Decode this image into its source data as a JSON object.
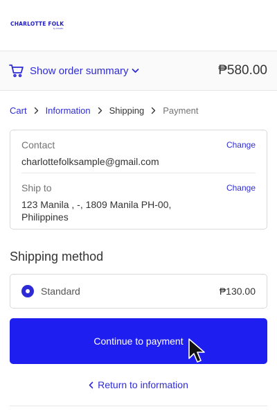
{
  "brand": {
    "name": "CHARLOTTE FOLK",
    "tagline": "by cinnabu"
  },
  "summary": {
    "toggle_label": "Show order summary",
    "total": "₱580.00"
  },
  "breadcrumb": {
    "cart": "Cart",
    "information": "Information",
    "shipping": "Shipping",
    "payment": "Payment"
  },
  "review": {
    "contact_label": "Contact",
    "contact_value": "charlottefolksample@gmail.com",
    "ship_label": "Ship to",
    "ship_line1": "123 Manila , -, 1809 Manila PH-00,",
    "ship_line2": "Philippines",
    "change_label": "Change"
  },
  "shipping_method": {
    "title": "Shipping method",
    "option_name": "Standard",
    "option_price": "₱130.00",
    "selected": true
  },
  "actions": {
    "continue_label": "Continue to payment",
    "return_label": "Return to information"
  },
  "colors": {
    "accent": "#2e2bd6",
    "button": "#1f1ef0"
  },
  "icons": {
    "cart": "cart-icon",
    "toggle": "chevron-down-icon",
    "breadcrumb_sep": "chevron-right-icon",
    "return": "chevron-left-icon",
    "cursor": "mouse-pointer-icon"
  }
}
